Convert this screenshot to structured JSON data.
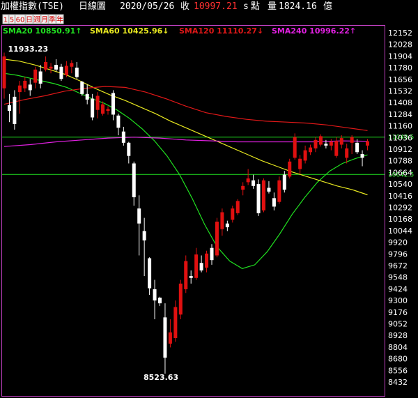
{
  "header": {
    "index_name": "加權指數(TSE)",
    "chart_kind": "日線圖",
    "date": "2020/05/26",
    "close_label": "收",
    "close_value": "10997.21",
    "close_suffix": "s",
    "points_label": "點",
    "volume_label": "量",
    "volume_value": "1824.16",
    "volume_unit": "億"
  },
  "tabs": [
    "1",
    "5",
    "60",
    "日",
    "週",
    "月",
    "季",
    "年"
  ],
  "colors": {
    "background": "#000000",
    "frame": "#c040c0",
    "up_candle": "#e01010",
    "down_candle": "#ffffff",
    "sma20": "#20e020",
    "sma60": "#e8e820",
    "sma120": "#e01818",
    "sma240": "#e020e0",
    "ref_line": "#20e020"
  },
  "chart_data": {
    "type": "candlestick",
    "x_axis": "trading days (daily)",
    "y_ticks": [
      12152,
      12028,
      11904,
      11780,
      11656,
      11532,
      11408,
      11284,
      11160,
      11036,
      10912,
      10788,
      10664,
      10540,
      10416,
      10292,
      10168,
      10044,
      9920,
      9796,
      9672,
      9548,
      9424,
      9300,
      9176,
      9052,
      8928,
      8804,
      8680,
      8556,
      8432
    ],
    "ylim": [
      8380,
      12200
    ],
    "reference_lines": [
      {
        "value": 11040.5,
        "label": "11040.5"
      },
      {
        "value": 10642.5,
        "label": "10642.5"
      }
    ],
    "annotations": {
      "high": {
        "value": "11933.23",
        "index": 1
      },
      "low": {
        "value": "8523.63",
        "index": 38
      }
    },
    "legend": [
      {
        "name": "SMA20",
        "value": "10850.91",
        "arrow": "↑",
        "color": "#20e020"
      },
      {
        "name": "SMA60",
        "value": "10425.96",
        "arrow": "↓",
        "color": "#e8e820"
      },
      {
        "name": "SMA120",
        "value": "11110.27",
        "arrow": "↓",
        "color": "#e01818"
      },
      {
        "name": "SMA240",
        "value": "10996.22",
        "arrow": "↑",
        "color": "#e020e0"
      }
    ],
    "candles": [
      {
        "o": 11560,
        "h": 11940,
        "l": 11450,
        "c": 11900
      },
      {
        "o": 11380,
        "h": 11500,
        "l": 11200,
        "c": 11320
      },
      {
        "o": 11470,
        "h": 11540,
        "l": 11120,
        "c": 11180
      },
      {
        "o": 11520,
        "h": 11640,
        "l": 11290,
        "c": 11590
      },
      {
        "o": 11560,
        "h": 11680,
        "l": 11520,
        "c": 11640
      },
      {
        "o": 11600,
        "h": 11660,
        "l": 11480,
        "c": 11540
      },
      {
        "o": 11620,
        "h": 11790,
        "l": 11560,
        "c": 11760
      },
      {
        "o": 11740,
        "h": 11810,
        "l": 11560,
        "c": 11610
      },
      {
        "o": 11760,
        "h": 11900,
        "l": 11740,
        "c": 11840
      },
      {
        "o": 11770,
        "h": 11830,
        "l": 11720,
        "c": 11790
      },
      {
        "o": 11810,
        "h": 11870,
        "l": 11740,
        "c": 11760
      },
      {
        "o": 11790,
        "h": 11820,
        "l": 11640,
        "c": 11660
      },
      {
        "o": 11700,
        "h": 11850,
        "l": 11680,
        "c": 11800
      },
      {
        "o": 11790,
        "h": 11860,
        "l": 11720,
        "c": 11830
      },
      {
        "o": 11780,
        "h": 11840,
        "l": 11660,
        "c": 11680
      },
      {
        "o": 11630,
        "h": 11640,
        "l": 11480,
        "c": 11500
      },
      {
        "o": 11500,
        "h": 11600,
        "l": 11390,
        "c": 11440
      },
      {
        "o": 11450,
        "h": 11500,
        "l": 11220,
        "c": 11250
      },
      {
        "o": 11330,
        "h": 11520,
        "l": 11240,
        "c": 11480
      },
      {
        "o": 11290,
        "h": 11420,
        "l": 11270,
        "c": 11390
      },
      {
        "o": 11320,
        "h": 11370,
        "l": 11280,
        "c": 11340
      },
      {
        "o": 11510,
        "h": 11540,
        "l": 11220,
        "c": 11280
      },
      {
        "o": 11270,
        "h": 11290,
        "l": 11060,
        "c": 11140
      },
      {
        "o": 11100,
        "h": 11150,
        "l": 10950,
        "c": 10980
      },
      {
        "o": 10980,
        "h": 10990,
        "l": 10760,
        "c": 10840
      },
      {
        "o": 10760,
        "h": 10780,
        "l": 10310,
        "c": 10400
      },
      {
        "o": 10280,
        "h": 10420,
        "l": 9780,
        "c": 10120
      },
      {
        "o": 10040,
        "h": 10180,
        "l": 9560,
        "c": 9940
      },
      {
        "o": 9750,
        "h": 9760,
        "l": 9360,
        "c": 9430
      },
      {
        "o": 9420,
        "h": 9520,
        "l": 9100,
        "c": 9300
      },
      {
        "o": 9330,
        "h": 9340,
        "l": 9240,
        "c": 9270
      },
      {
        "o": 9120,
        "h": 9270,
        "l": 8520,
        "c": 8690
      },
      {
        "o": 8840,
        "h": 9100,
        "l": 8800,
        "c": 8960
      },
      {
        "o": 8900,
        "h": 9300,
        "l": 8860,
        "c": 9230
      },
      {
        "o": 9150,
        "h": 9520,
        "l": 9100,
        "c": 9480
      },
      {
        "o": 9420,
        "h": 9780,
        "l": 9380,
        "c": 9720
      },
      {
        "o": 9560,
        "h": 9620,
        "l": 9480,
        "c": 9540
      },
      {
        "o": 9540,
        "h": 9860,
        "l": 9520,
        "c": 9790
      },
      {
        "o": 9700,
        "h": 9780,
        "l": 9600,
        "c": 9620
      },
      {
        "o": 9650,
        "h": 9830,
        "l": 9600,
        "c": 9800
      },
      {
        "o": 9860,
        "h": 9900,
        "l": 9680,
        "c": 9730
      },
      {
        "o": 9780,
        "h": 10180,
        "l": 9760,
        "c": 10140
      },
      {
        "o": 10060,
        "h": 10280,
        "l": 9990,
        "c": 10240
      },
      {
        "o": 10120,
        "h": 10150,
        "l": 10040,
        "c": 10080
      },
      {
        "o": 10160,
        "h": 10310,
        "l": 10130,
        "c": 10280
      },
      {
        "o": 10230,
        "h": 10380,
        "l": 10210,
        "c": 10360
      },
      {
        "o": 10480,
        "h": 10560,
        "l": 10420,
        "c": 10520
      },
      {
        "o": 10560,
        "h": 10700,
        "l": 10530,
        "c": 10600
      },
      {
        "o": 10580,
        "h": 10640,
        "l": 10490,
        "c": 10520
      },
      {
        "o": 10540,
        "h": 10590,
        "l": 10200,
        "c": 10230
      },
      {
        "o": 10260,
        "h": 10600,
        "l": 10240,
        "c": 10580
      },
      {
        "o": 10500,
        "h": 10570,
        "l": 10440,
        "c": 10460
      },
      {
        "o": 10390,
        "h": 10450,
        "l": 10260,
        "c": 10300
      },
      {
        "o": 10350,
        "h": 10620,
        "l": 10330,
        "c": 10580
      },
      {
        "o": 10640,
        "h": 10680,
        "l": 10450,
        "c": 10480
      },
      {
        "o": 10620,
        "h": 10810,
        "l": 10600,
        "c": 10780
      },
      {
        "o": 10820,
        "h": 11080,
        "l": 10800,
        "c": 11040
      },
      {
        "o": 10700,
        "h": 10850,
        "l": 10650,
        "c": 10810
      },
      {
        "o": 10790,
        "h": 10950,
        "l": 10760,
        "c": 10900
      },
      {
        "o": 10880,
        "h": 10960,
        "l": 10850,
        "c": 10930
      },
      {
        "o": 10920,
        "h": 11040,
        "l": 10880,
        "c": 11010
      },
      {
        "o": 10960,
        "h": 11070,
        "l": 10940,
        "c": 11050
      },
      {
        "o": 10970,
        "h": 11010,
        "l": 10920,
        "c": 10950
      },
      {
        "o": 10950,
        "h": 11020,
        "l": 10900,
        "c": 10990
      },
      {
        "o": 10840,
        "h": 11040,
        "l": 10820,
        "c": 11000
      },
      {
        "o": 10960,
        "h": 11060,
        "l": 10920,
        "c": 11030
      },
      {
        "o": 10820,
        "h": 10970,
        "l": 10760,
        "c": 10920
      },
      {
        "o": 10980,
        "h": 11060,
        "l": 10860,
        "c": 11040
      },
      {
        "o": 10980,
        "h": 11020,
        "l": 10860,
        "c": 10880
      },
      {
        "o": 10860,
        "h": 10900,
        "l": 10730,
        "c": 10820
      },
      {
        "o": 10950,
        "h": 11020,
        "l": 10900,
        "c": 10997
      }
    ],
    "sma_lines": {
      "sma20": [
        11720,
        11700,
        11670,
        11640,
        11610,
        11570,
        11510,
        11450,
        11400,
        11330,
        11240,
        11130,
        11000,
        10840,
        10640,
        10390,
        10110,
        9870,
        9720,
        9640,
        9680,
        9820,
        10010,
        10220,
        10400,
        10560,
        10680,
        10760,
        10810,
        10851
      ],
      "sma60": [
        11870,
        11850,
        11810,
        11760,
        11710,
        11640,
        11560,
        11490,
        11430,
        11360,
        11290,
        11210,
        11140,
        11070,
        11000,
        10930,
        10860,
        10790,
        10730,
        10670,
        10620,
        10570,
        10520,
        10480,
        10426
      ],
      "sma120": [
        11390,
        11440,
        11480,
        11530,
        11560,
        11580,
        11570,
        11520,
        11450,
        11370,
        11300,
        11260,
        11230,
        11210,
        11200,
        11190,
        11170,
        11140,
        11110
      ],
      "sma240": [
        10940,
        10960,
        10990,
        11010,
        11030,
        11040,
        11030,
        11010,
        11000,
        10990,
        10990,
        10990,
        10990,
        11000,
        10996
      ]
    }
  }
}
